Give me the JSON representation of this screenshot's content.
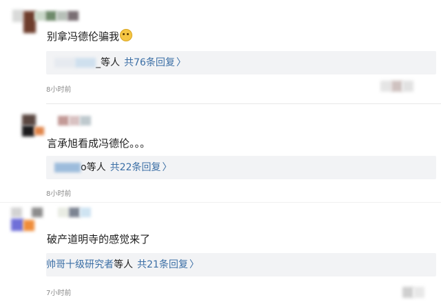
{
  "comments": [
    {
      "text": "别拿冯德伦骗我",
      "emoji_icon": "grin-emoji-icon",
      "reply_suffix": "_等人",
      "reply_count": "共76条回复",
      "time": "8小时前"
    },
    {
      "text": "言承旭看成冯德伦。。。",
      "reply_suffix": "o等人",
      "reply_count": "共22条回复",
      "time": "8小时前"
    },
    {
      "text": "破产道明寺的感觉来了",
      "reply_name": "帅哥十级研究者",
      "reply_suffix": "等人",
      "reply_count": "共21条回复",
      "time": "7小时前"
    }
  ],
  "icons": {
    "chevron": "chevron-right-icon"
  },
  "colors": {
    "link": "#3a6ea5",
    "reply_bg": "#f2f3f5",
    "meta": "#8a8a8a"
  }
}
